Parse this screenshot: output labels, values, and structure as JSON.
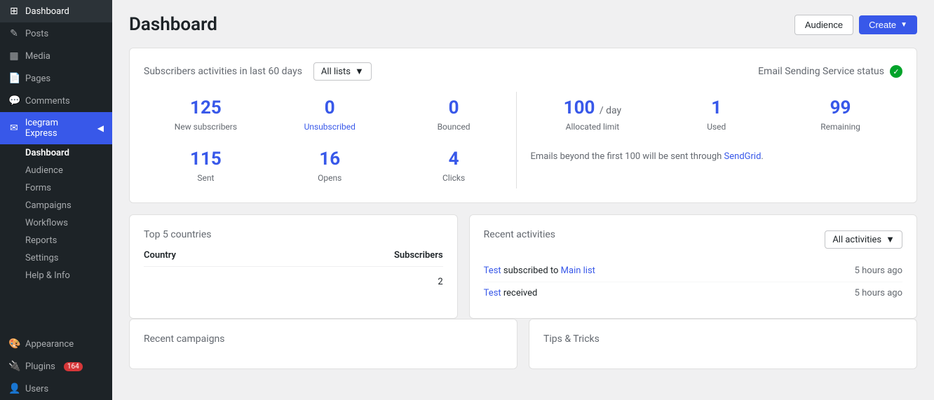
{
  "sidebar": {
    "items": [
      {
        "id": "dashboard-top",
        "label": "Dashboard",
        "icon": "⊞"
      },
      {
        "id": "posts",
        "label": "Posts",
        "icon": "✎"
      },
      {
        "id": "media",
        "label": "Media",
        "icon": "⬜"
      },
      {
        "id": "pages",
        "label": "Pages",
        "icon": "📄"
      },
      {
        "id": "comments",
        "label": "Comments",
        "icon": "💬"
      },
      {
        "id": "icegram",
        "label": "Icegram Express",
        "icon": "✉"
      }
    ],
    "sub_items": [
      {
        "id": "dashboard-sub",
        "label": "Dashboard",
        "active": true
      },
      {
        "id": "audience",
        "label": "Audience"
      },
      {
        "id": "forms",
        "label": "Forms"
      },
      {
        "id": "campaigns",
        "label": "Campaigns"
      },
      {
        "id": "workflows",
        "label": "Workflows"
      },
      {
        "id": "reports",
        "label": "Reports"
      },
      {
        "id": "settings",
        "label": "Settings"
      },
      {
        "id": "help",
        "label": "Help & Info"
      }
    ],
    "bottom_items": [
      {
        "id": "appearance",
        "label": "Appearance",
        "icon": "🎨"
      },
      {
        "id": "plugins",
        "label": "Plugins",
        "icon": "🔌",
        "badge": "164"
      },
      {
        "id": "users",
        "label": "Users",
        "icon": "👤"
      }
    ]
  },
  "header": {
    "title": "Dashboard",
    "audience_btn": "Audience",
    "create_btn": "Create"
  },
  "stats_card": {
    "title": "Subscribers activities in last 60 days",
    "filter_label": "All lists",
    "email_status_title": "Email Sending Service status",
    "stats_left": [
      {
        "value": "125",
        "label": "New subscribers"
      },
      {
        "value": "0",
        "label": "Unsubscribed",
        "label_blue": true
      },
      {
        "value": "0",
        "label": "Bounced"
      }
    ],
    "stats_left_row2": [
      {
        "value": "115",
        "label": "Sent"
      },
      {
        "value": "16",
        "label": "Opens"
      },
      {
        "value": "4",
        "label": "Clicks"
      }
    ],
    "stats_right": [
      {
        "value": "100",
        "unit": "/ day",
        "label": "Allocated limit"
      },
      {
        "value": "1",
        "label": "Used"
      },
      {
        "value": "99",
        "label": "Remaining"
      }
    ],
    "email_info": "Emails beyond the first 100 will be sent through",
    "sendgrid_link": "SendGrid"
  },
  "countries": {
    "title": "Top 5 countries",
    "col_country": "Country",
    "col_subscribers": "Subscribers",
    "rows": [
      {
        "country": "",
        "subscribers": "2"
      }
    ]
  },
  "activities": {
    "title": "Recent activities",
    "filter_label": "All activities",
    "rows": [
      {
        "text_parts": [
          "Test",
          " subscribed to ",
          "Main list"
        ],
        "links": [
          0,
          2
        ],
        "time": "5 hours ago"
      },
      {
        "text_parts": [
          "Test",
          " received"
        ],
        "links": [
          0
        ],
        "time": "5 hours ago"
      }
    ]
  },
  "recent_campaigns": {
    "title": "Recent campaigns"
  },
  "tips": {
    "title": "Tips & Tricks"
  },
  "colors": {
    "accent": "#3858e9",
    "sidebar_bg": "#1d2327",
    "active_menu": "#3858e9"
  }
}
